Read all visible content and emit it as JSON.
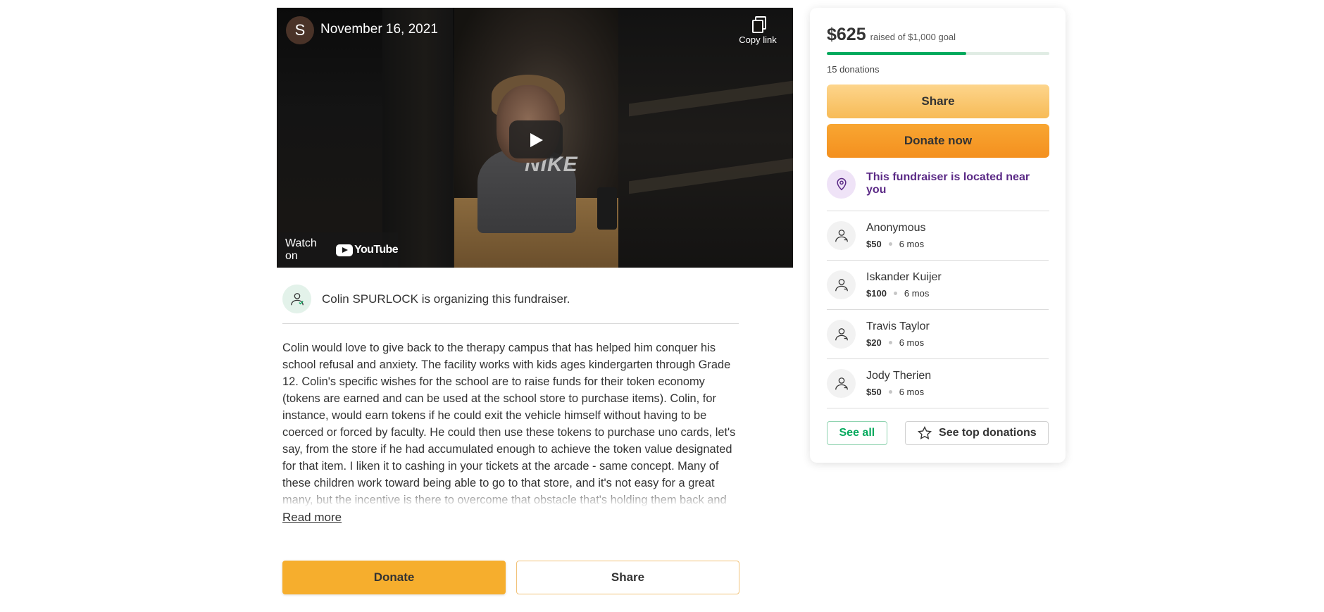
{
  "video": {
    "channel_initial": "S",
    "title": "November 16, 2021",
    "copy_link_label": "Copy link",
    "watch_on_label": "Watch on",
    "youtube_label": "YouTube",
    "shirt_text": "NIKE"
  },
  "organizer": {
    "text": "Colin SPURLOCK is organizing this fundraiser."
  },
  "story": {
    "text": "Colin would love to give back to the therapy campus that has helped him conquer his school refusal and anxiety. The facility works with kids ages kindergarten through Grade 12. Colin's specific wishes for the school are to raise funds for their token economy (tokens are earned and can be used at the school store to purchase items). Colin, for instance, would earn tokens if he could exit the vehicle himself without having to be coerced or forced by faculty. He could then use these tokens to purchase uno cards, let's say, from the store if he had accumulated enough to achieve the token value designated for that item. I liken it to cashing in your tickets at the arcade - same concept. Many of these children work toward being able to go to that store, and it's not easy for a great many, but the incentive is there to overcome that obstacle that's holding them back and they look forward to that purchase",
    "read_more": "Read more"
  },
  "actions": {
    "donate_label": "Donate",
    "share_label": "Share"
  },
  "sidebar": {
    "raised": "$625",
    "goal_text": "raised of $1,000 goal",
    "progress_fraction": 0.625,
    "donation_count": "15 donations",
    "share_label": "Share",
    "donate_label": "Donate now",
    "location_text": "This fundraiser is located near you",
    "donors": [
      {
        "name": "Anonymous",
        "amount": "$50",
        "time": "6 mos"
      },
      {
        "name": "Iskander Kuijer",
        "amount": "$100",
        "time": "6 mos"
      },
      {
        "name": "Travis Taylor",
        "amount": "$20",
        "time": "6 mos"
      },
      {
        "name": "Jody Therien",
        "amount": "$50",
        "time": "6 mos"
      }
    ],
    "see_all_label": "See all",
    "see_top_label": "See top donations"
  },
  "colors": {
    "donate_orange": "#f6ae2d",
    "progress_green": "#02a95c",
    "location_purple": "#5b2a86"
  }
}
